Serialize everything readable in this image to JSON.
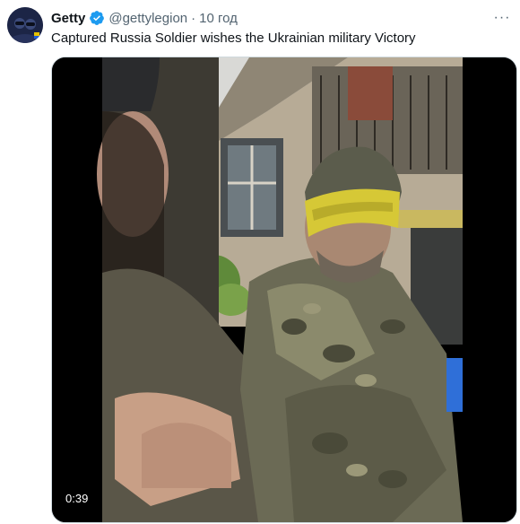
{
  "tweet": {
    "author_name": "Getty",
    "author_handle": "@gettylegion",
    "separator": "·",
    "timestamp": "10 год",
    "text": "Captured Russia Soldier wishes the Ukrainian military Victory",
    "more_label": "···"
  },
  "video": {
    "duration": "0:39"
  },
  "colors": {
    "verified": "#1d9bf0",
    "secondary_text": "#536471",
    "media_border": "#cfd9de"
  },
  "icons": {
    "verified": "verified-badge-icon",
    "more": "more-options-icon"
  }
}
